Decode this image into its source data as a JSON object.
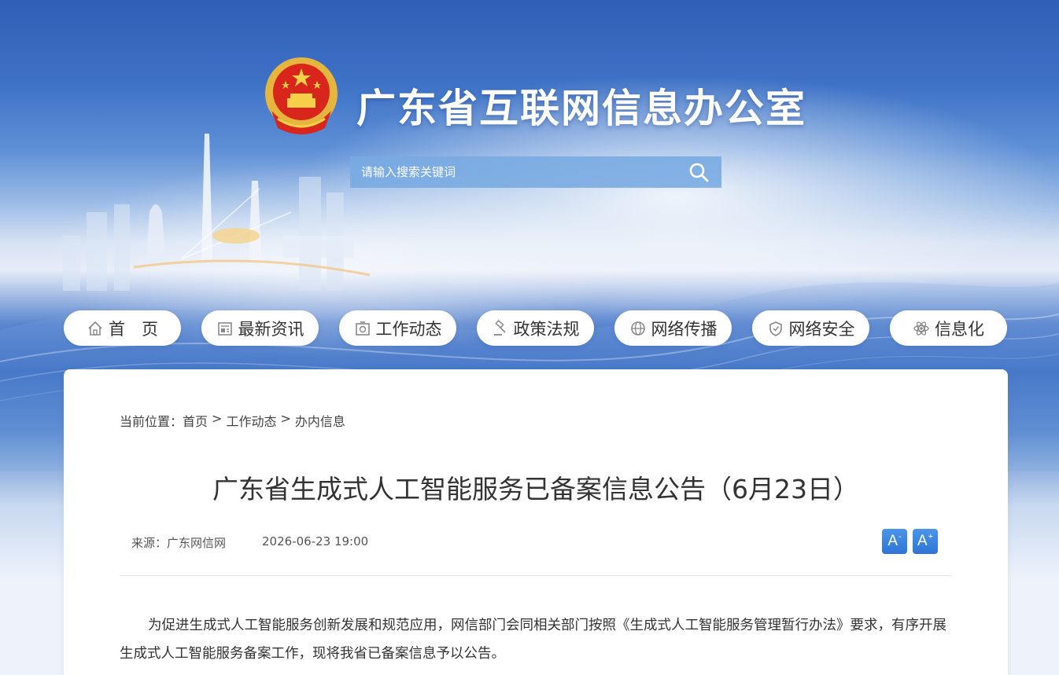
{
  "header": {
    "site_title": "广东省互联网信息办公室",
    "emblem_icon": "national-emblem-icon"
  },
  "search": {
    "placeholder": "请输入搜索关键词",
    "button_icon": "search-icon"
  },
  "nav": {
    "items": [
      {
        "label": "首　页",
        "icon": "home-icon"
      },
      {
        "label": "最新资讯",
        "icon": "news-icon"
      },
      {
        "label": "工作动态",
        "icon": "work-icon"
      },
      {
        "label": "政策法规",
        "icon": "gavel-icon"
      },
      {
        "label": "网络传播",
        "icon": "globe-icon"
      },
      {
        "label": "网络安全",
        "icon": "shield-icon"
      },
      {
        "label": "信息化",
        "icon": "atom-icon"
      }
    ]
  },
  "breadcrumb": {
    "prefix": "当前位置：",
    "items": [
      "首页",
      "工作动态",
      "办内信息"
    ],
    "separator": ">"
  },
  "article": {
    "title": "广东省生成式人工智能服务已备案信息公告（6月23日）",
    "source": "来源：广东网信网",
    "date": "2026-06-23 19:00",
    "font_decrease_label": "A",
    "font_decrease_sup": "-",
    "font_increase_label": "A",
    "font_increase_sup": "+",
    "paragraph": "为促进生成式人工智能服务创新发展和规范应用，网信部门会同相关部门按照《生成式人工智能服务管理暂行办法》要求，有序开展生成式人工智能服务备案工作，现将我省已备案信息予以公告。"
  },
  "colors": {
    "accent": "#2f74d6",
    "banner_blue": "#3c6fc4",
    "text": "#333333"
  }
}
